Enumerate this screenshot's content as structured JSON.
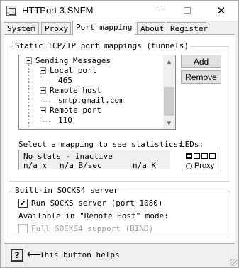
{
  "window": {
    "title": "HTTPort 3.SNFM",
    "minimize_icon": "minimize-icon",
    "maximize_icon": "maximize-icon",
    "close_glyph": "✕"
  },
  "tabs": [
    {
      "label": "System"
    },
    {
      "label": "Proxy"
    },
    {
      "label": "Port mapping",
      "active": true
    },
    {
      "label": "About"
    },
    {
      "label": "Register"
    }
  ],
  "port_mappings": {
    "group_title": "Static TCP/IP port mappings (tunnels)",
    "tree": {
      "root": "Sending Messages",
      "local_port_label": "Local port",
      "local_port_value": "465",
      "remote_host_label": "Remote host",
      "remote_host_value": "smtp.gmail.com",
      "remote_port_label": "Remote port",
      "remote_port_value": "110"
    },
    "add_button": "Add",
    "remove_button": "Remove",
    "stats_prompt": "Select a mapping to see statistics:",
    "stats_line1": "No stats - inactive",
    "stats_x": "n/a x",
    "stats_bsec": "n/a B/sec",
    "stats_k": "n/a K",
    "leds_label": "LEDs:",
    "proxy_radio_label": "Proxy"
  },
  "socks": {
    "group_title": "Built-in SOCKS4 server",
    "run_checkbox_label": "Run SOCKS server (port 1080)",
    "run_checked": "✔",
    "available_text": "Available in \"Remote Host\" mode:",
    "full_support_label": "Full SOCKS4 support (BIND)"
  },
  "footer": {
    "help_button": "?",
    "arrow": "⟵",
    "help_text": "This button helps"
  },
  "colors": {
    "panel": "#ffffff",
    "window_bg": "#f0f0f0",
    "border": "#adadad",
    "disabled": "#a0a0a0"
  }
}
